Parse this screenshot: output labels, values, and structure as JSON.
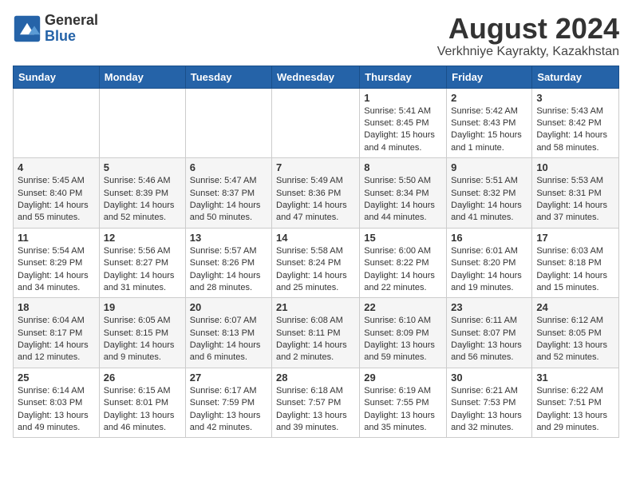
{
  "logo": {
    "general": "General",
    "blue": "Blue"
  },
  "title": "August 2024",
  "subtitle": "Verkhniye Kayrakty, Kazakhstan",
  "weekdays": [
    "Sunday",
    "Monday",
    "Tuesday",
    "Wednesday",
    "Thursday",
    "Friday",
    "Saturday"
  ],
  "weeks": [
    [
      {
        "day": "",
        "info": ""
      },
      {
        "day": "",
        "info": ""
      },
      {
        "day": "",
        "info": ""
      },
      {
        "day": "",
        "info": ""
      },
      {
        "day": "1",
        "info": "Sunrise: 5:41 AM\nSunset: 8:45 PM\nDaylight: 15 hours\nand 4 minutes."
      },
      {
        "day": "2",
        "info": "Sunrise: 5:42 AM\nSunset: 8:43 PM\nDaylight: 15 hours\nand 1 minute."
      },
      {
        "day": "3",
        "info": "Sunrise: 5:43 AM\nSunset: 8:42 PM\nDaylight: 14 hours\nand 58 minutes."
      }
    ],
    [
      {
        "day": "4",
        "info": "Sunrise: 5:45 AM\nSunset: 8:40 PM\nDaylight: 14 hours\nand 55 minutes."
      },
      {
        "day": "5",
        "info": "Sunrise: 5:46 AM\nSunset: 8:39 PM\nDaylight: 14 hours\nand 52 minutes."
      },
      {
        "day": "6",
        "info": "Sunrise: 5:47 AM\nSunset: 8:37 PM\nDaylight: 14 hours\nand 50 minutes."
      },
      {
        "day": "7",
        "info": "Sunrise: 5:49 AM\nSunset: 8:36 PM\nDaylight: 14 hours\nand 47 minutes."
      },
      {
        "day": "8",
        "info": "Sunrise: 5:50 AM\nSunset: 8:34 PM\nDaylight: 14 hours\nand 44 minutes."
      },
      {
        "day": "9",
        "info": "Sunrise: 5:51 AM\nSunset: 8:32 PM\nDaylight: 14 hours\nand 41 minutes."
      },
      {
        "day": "10",
        "info": "Sunrise: 5:53 AM\nSunset: 8:31 PM\nDaylight: 14 hours\nand 37 minutes."
      }
    ],
    [
      {
        "day": "11",
        "info": "Sunrise: 5:54 AM\nSunset: 8:29 PM\nDaylight: 14 hours\nand 34 minutes."
      },
      {
        "day": "12",
        "info": "Sunrise: 5:56 AM\nSunset: 8:27 PM\nDaylight: 14 hours\nand 31 minutes."
      },
      {
        "day": "13",
        "info": "Sunrise: 5:57 AM\nSunset: 8:26 PM\nDaylight: 14 hours\nand 28 minutes."
      },
      {
        "day": "14",
        "info": "Sunrise: 5:58 AM\nSunset: 8:24 PM\nDaylight: 14 hours\nand 25 minutes."
      },
      {
        "day": "15",
        "info": "Sunrise: 6:00 AM\nSunset: 8:22 PM\nDaylight: 14 hours\nand 22 minutes."
      },
      {
        "day": "16",
        "info": "Sunrise: 6:01 AM\nSunset: 8:20 PM\nDaylight: 14 hours\nand 19 minutes."
      },
      {
        "day": "17",
        "info": "Sunrise: 6:03 AM\nSunset: 8:18 PM\nDaylight: 14 hours\nand 15 minutes."
      }
    ],
    [
      {
        "day": "18",
        "info": "Sunrise: 6:04 AM\nSunset: 8:17 PM\nDaylight: 14 hours\nand 12 minutes."
      },
      {
        "day": "19",
        "info": "Sunrise: 6:05 AM\nSunset: 8:15 PM\nDaylight: 14 hours\nand 9 minutes."
      },
      {
        "day": "20",
        "info": "Sunrise: 6:07 AM\nSunset: 8:13 PM\nDaylight: 14 hours\nand 6 minutes."
      },
      {
        "day": "21",
        "info": "Sunrise: 6:08 AM\nSunset: 8:11 PM\nDaylight: 14 hours\nand 2 minutes."
      },
      {
        "day": "22",
        "info": "Sunrise: 6:10 AM\nSunset: 8:09 PM\nDaylight: 13 hours\nand 59 minutes."
      },
      {
        "day": "23",
        "info": "Sunrise: 6:11 AM\nSunset: 8:07 PM\nDaylight: 13 hours\nand 56 minutes."
      },
      {
        "day": "24",
        "info": "Sunrise: 6:12 AM\nSunset: 8:05 PM\nDaylight: 13 hours\nand 52 minutes."
      }
    ],
    [
      {
        "day": "25",
        "info": "Sunrise: 6:14 AM\nSunset: 8:03 PM\nDaylight: 13 hours\nand 49 minutes."
      },
      {
        "day": "26",
        "info": "Sunrise: 6:15 AM\nSunset: 8:01 PM\nDaylight: 13 hours\nand 46 minutes."
      },
      {
        "day": "27",
        "info": "Sunrise: 6:17 AM\nSunset: 7:59 PM\nDaylight: 13 hours\nand 42 minutes."
      },
      {
        "day": "28",
        "info": "Sunrise: 6:18 AM\nSunset: 7:57 PM\nDaylight: 13 hours\nand 39 minutes."
      },
      {
        "day": "29",
        "info": "Sunrise: 6:19 AM\nSunset: 7:55 PM\nDaylight: 13 hours\nand 35 minutes."
      },
      {
        "day": "30",
        "info": "Sunrise: 6:21 AM\nSunset: 7:53 PM\nDaylight: 13 hours\nand 32 minutes."
      },
      {
        "day": "31",
        "info": "Sunrise: 6:22 AM\nSunset: 7:51 PM\nDaylight: 13 hours\nand 29 minutes."
      }
    ]
  ]
}
